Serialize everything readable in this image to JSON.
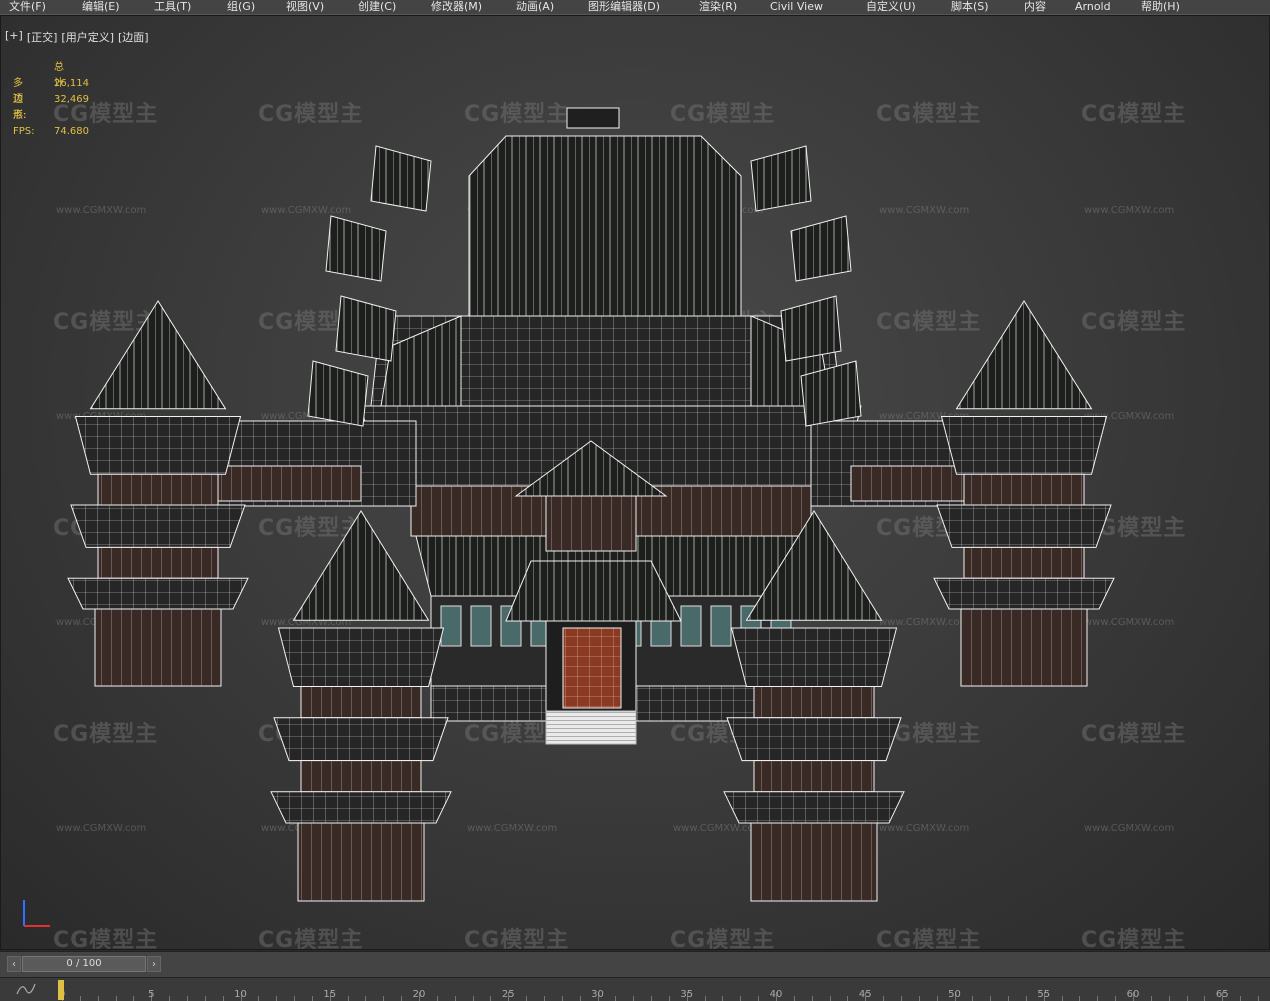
{
  "menu": [
    "文件(F)",
    "编辑(E)",
    "工具(T)",
    "组(G)",
    "视图(V)",
    "创建(C)",
    "修改器(M)",
    "动画(A)",
    "图形编辑器(D)",
    "渲染(R)",
    "Civil View",
    "自定义(U)",
    "脚本(S)",
    "内容",
    "Arnold",
    "帮助(H)"
  ],
  "viewport": {
    "label_parts": [
      "[+]",
      "[正交]",
      "[用户定义]",
      "[边面]"
    ],
    "stats": {
      "total_label": "总计",
      "polys_label": "多边形:",
      "polys_value": "26,114",
      "verts_label": "顶点:",
      "verts_value": "32,469",
      "fps_label": "FPS:",
      "fps_value": "74.680"
    },
    "watermark_text": "CG模型主",
    "watermark_url": "www.CGMXW.com"
  },
  "timeline": {
    "frame_display": "0 / 100",
    "prev_icon": "prev-frame-icon",
    "next_icon": "next-frame-icon"
  },
  "trackbar": {
    "ticks": [
      "0",
      "5",
      "10",
      "15",
      "20",
      "25",
      "30",
      "35",
      "40",
      "45",
      "50",
      "55",
      "60",
      "65"
    ]
  },
  "colors": {
    "stats_text": "#e0c040",
    "wireframe": "#ffffff",
    "door": "#8a3a22",
    "viewport_bg": "#3c3c3c"
  }
}
